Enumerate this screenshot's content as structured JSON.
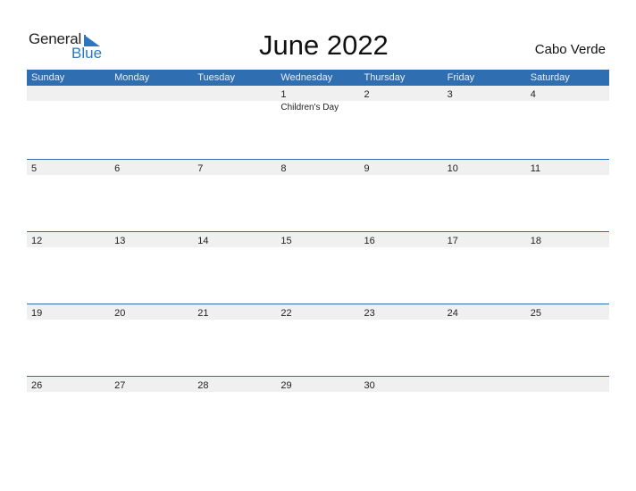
{
  "logo": {
    "general": "General",
    "blue": "Blue",
    "accent_color": "#2a78c2"
  },
  "title": "June 2022",
  "country": "Cabo Verde",
  "header_color": "#2f6eb0",
  "days": [
    "Sunday",
    "Monday",
    "Tuesday",
    "Wednesday",
    "Thursday",
    "Friday",
    "Saturday"
  ],
  "weeks": [
    {
      "dates": [
        "",
        "",
        "",
        "1",
        "2",
        "3",
        "4"
      ],
      "events": [
        "",
        "",
        "",
        "Children's Day",
        "",
        "",
        ""
      ]
    },
    {
      "dates": [
        "5",
        "6",
        "7",
        "8",
        "9",
        "10",
        "11"
      ],
      "events": [
        "",
        "",
        "",
        "",
        "",
        "",
        ""
      ]
    },
    {
      "dates": [
        "12",
        "13",
        "14",
        "15",
        "16",
        "17",
        "18"
      ],
      "events": [
        "",
        "",
        "",
        "",
        "",
        "",
        ""
      ]
    },
    {
      "dates": [
        "19",
        "20",
        "21",
        "22",
        "23",
        "24",
        "25"
      ],
      "events": [
        "",
        "",
        "",
        "",
        "",
        "",
        ""
      ]
    },
    {
      "dates": [
        "26",
        "27",
        "28",
        "29",
        "30",
        "",
        ""
      ],
      "events": [
        "",
        "",
        "",
        "",
        "",
        "",
        ""
      ]
    }
  ]
}
